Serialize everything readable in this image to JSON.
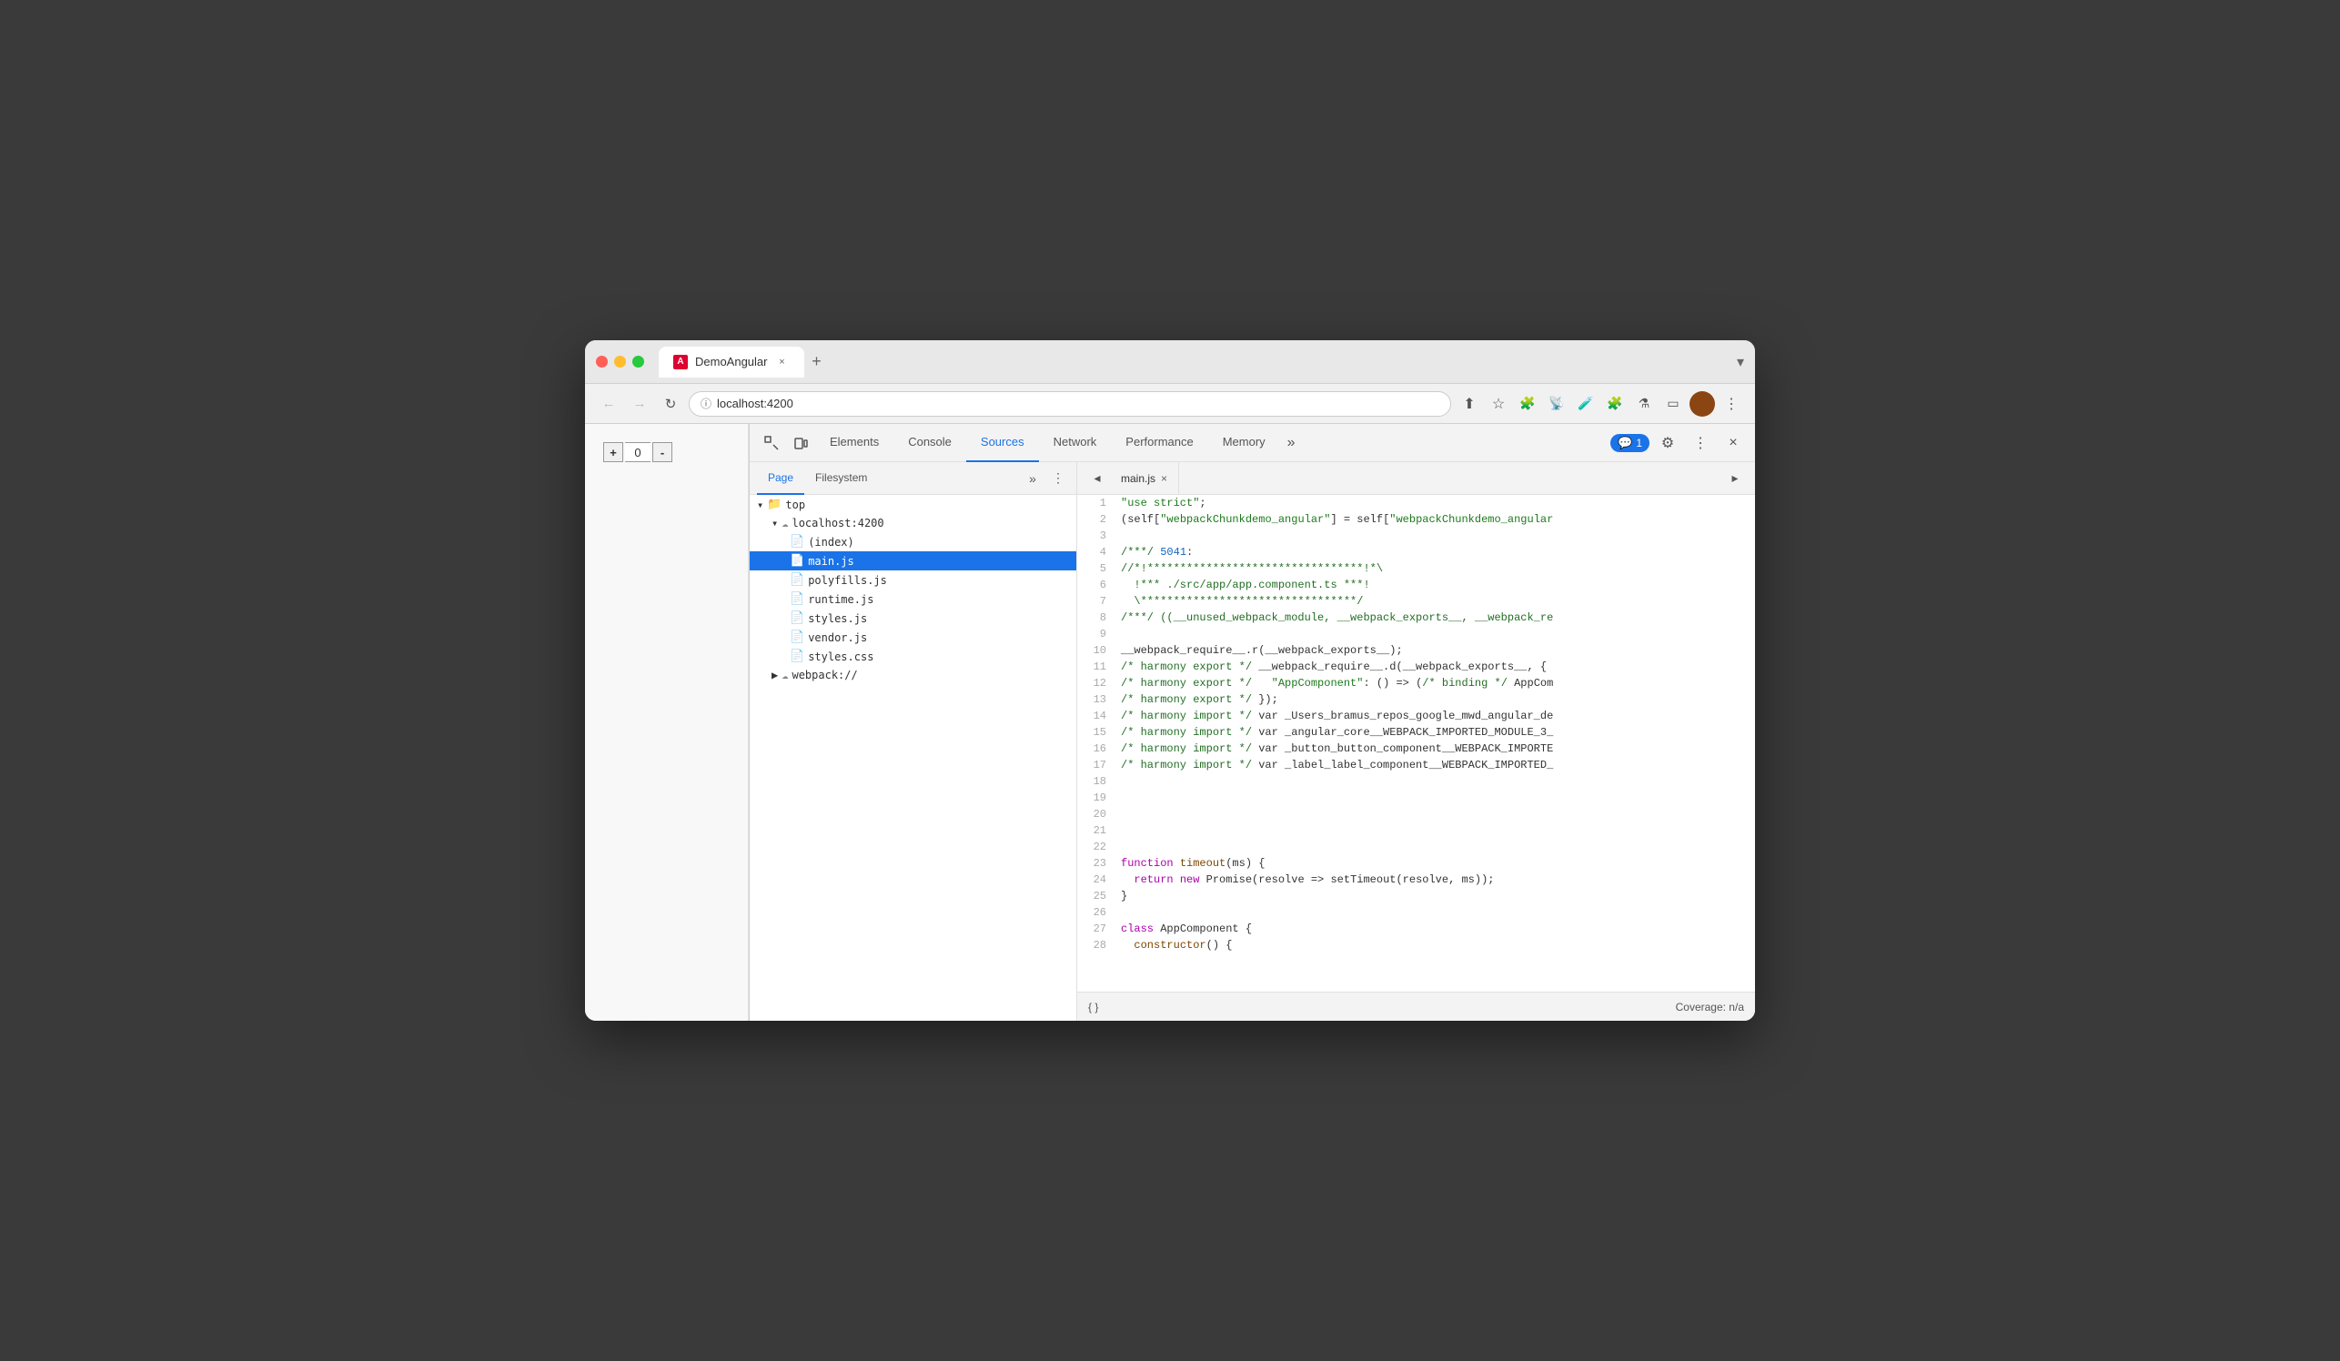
{
  "browser": {
    "tab_title": "DemoAngular",
    "tab_favicon_letter": "A",
    "url": "localhost:4200"
  },
  "devtools": {
    "tabs": [
      "Elements",
      "Console",
      "Sources",
      "Network",
      "Performance",
      "Memory"
    ],
    "active_tab": "Sources",
    "badge_count": "1",
    "file_panel": {
      "tabs": [
        "Page",
        "Filesystem"
      ],
      "active_tab": "Page",
      "tree": [
        {
          "level": 0,
          "label": "top",
          "type": "folder",
          "expanded": true,
          "icon": "folder"
        },
        {
          "level": 1,
          "label": "localhost:4200",
          "type": "domain",
          "expanded": true,
          "icon": "cloud"
        },
        {
          "level": 2,
          "label": "(index)",
          "type": "file-white",
          "selected": false
        },
        {
          "level": 2,
          "label": "main.js",
          "type": "file-yellow",
          "selected": true
        },
        {
          "level": 2,
          "label": "polyfills.js",
          "type": "file-yellow",
          "selected": false
        },
        {
          "level": 2,
          "label": "runtime.js",
          "type": "file-yellow",
          "selected": false
        },
        {
          "level": 2,
          "label": "styles.js",
          "type": "file-yellow",
          "selected": false
        },
        {
          "level": 2,
          "label": "vendor.js",
          "type": "file-yellow",
          "selected": false
        },
        {
          "level": 2,
          "label": "styles.css",
          "type": "file-purple",
          "selected": false
        },
        {
          "level": 1,
          "label": "webpack://",
          "type": "domain-collapsed",
          "expanded": false,
          "icon": "cloud"
        }
      ]
    },
    "code_panel": {
      "tab": "main.js",
      "lines": [
        {
          "n": 1,
          "code": "\"use strict\";"
        },
        {
          "n": 2,
          "code": "(self[\"webpackChunkdemo_angular\"] = self[\"webpackChunkdemo_angular"
        },
        {
          "n": 3,
          "code": ""
        },
        {
          "n": 4,
          "code": "/***/ 5041:"
        },
        {
          "n": 5,
          "code": "//*!*********************************!*\\"
        },
        {
          "n": 6,
          "code": "  !*** ./src/app/app.component.ts ***!"
        },
        {
          "n": 7,
          "code": "  \\*********************************/"
        },
        {
          "n": 8,
          "code": "/***/ ((__unused_webpack_module, __webpack_exports__, __webpack_re"
        },
        {
          "n": 9,
          "code": ""
        },
        {
          "n": 10,
          "code": "__webpack_require__.r(__webpack_exports__);"
        },
        {
          "n": 11,
          "code": "/* harmony export */ __webpack_require__.d(__webpack_exports__, {"
        },
        {
          "n": 12,
          "code": "/* harmony export */   \"AppComponent\": () => (/* binding */ AppCom"
        },
        {
          "n": 13,
          "code": "/* harmony export */ });"
        },
        {
          "n": 14,
          "code": "/* harmony import */ var _Users_bramus_repos_google_mwd_angular_de"
        },
        {
          "n": 15,
          "code": "/* harmony import */ var _angular_core__WEBPACK_IMPORTED_MODULE_3_"
        },
        {
          "n": 16,
          "code": "/* harmony import */ var _button_button_component__WEBPACK_IMPORTE"
        },
        {
          "n": 17,
          "code": "/* harmony import */ var _label_label_component__WEBPACK_IMPORTED_"
        },
        {
          "n": 18,
          "code": ""
        },
        {
          "n": 19,
          "code": ""
        },
        {
          "n": 20,
          "code": ""
        },
        {
          "n": 21,
          "code": ""
        },
        {
          "n": 22,
          "code": ""
        },
        {
          "n": 23,
          "code": "function timeout(ms) {"
        },
        {
          "n": 24,
          "code": "  return new Promise(resolve => setTimeout(resolve, ms));"
        },
        {
          "n": 25,
          "code": "}"
        },
        {
          "n": 26,
          "code": ""
        },
        {
          "n": 27,
          "code": "class AppComponent {"
        },
        {
          "n": 28,
          "code": "  constructor() {"
        }
      ]
    },
    "footer": {
      "coverage": "Coverage: n/a"
    }
  },
  "counter": {
    "minus": "-",
    "value": "0",
    "plus": "+"
  },
  "icons": {
    "back": "←",
    "forward": "→",
    "reload": "↻",
    "share": "⬆",
    "star": "☆",
    "extensions": "🧩",
    "more_vert": "⋮",
    "inspect": "⬚",
    "device": "⬚",
    "close_tab": "×",
    "new_tab": "+",
    "chevron_down": "▾",
    "dock_side": "⬚",
    "settings": "⚙",
    "more": "⋮",
    "collapse": "◂",
    "expand": "▸",
    "more_panel": "»",
    "curly": "{ }",
    "close_devtools": "×",
    "back_panel": "◂"
  }
}
